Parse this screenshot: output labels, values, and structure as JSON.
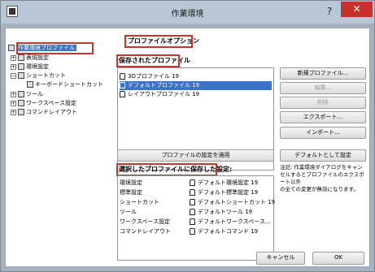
{
  "window": {
    "title": "作業環境",
    "help_glyph": "?",
    "close_glyph": "✕"
  },
  "tree": {
    "items": [
      {
        "label": "作業環境プロファイル",
        "expander": "",
        "selected": true
      },
      {
        "label": "表現設定",
        "expander": "+"
      },
      {
        "label": "環境設定",
        "expander": "+"
      },
      {
        "label": "ショートカット",
        "expander": "−"
      },
      {
        "label": "キーボードショートカット",
        "expander": ""
      },
      {
        "label": "ツール",
        "expander": "+"
      },
      {
        "label": "ワークスペース設定",
        "expander": "+"
      },
      {
        "label": "コマンドレイアウト",
        "expander": "+"
      }
    ]
  },
  "main": {
    "section_title": "プロファイルオプション",
    "saved_profiles_label": "保存されたプロファイル",
    "saved_profiles": [
      {
        "label": "3Dプロファイル 19",
        "selected": false
      },
      {
        "label": "デフォルトプロファイル 19",
        "selected": true
      },
      {
        "label": "レイアウトプロファイル 19",
        "selected": false
      }
    ],
    "buttons": {
      "new_profile": "新規プロファイル...",
      "edit": "編集...",
      "delete": "削除",
      "export": "エクスポート...",
      "import": "インポート...",
      "apply_profile": "プロファイルの設定を適用",
      "set_default": "デフォルトとして設定"
    },
    "stored_settings_label": "選択したプロファイルに保存した設定:",
    "stored_settings": [
      {
        "name": "環境設定",
        "value": "デフォルト環境設定 19"
      },
      {
        "name": "標準設定",
        "value": "デフォルト標準設定 19"
      },
      {
        "name": "ショートカット",
        "value": "デフォルトショートカット 19"
      },
      {
        "name": "ツール",
        "value": "デフォルトツール 19"
      },
      {
        "name": "ワークスペース設定",
        "value": "デフォルトワークスペース..."
      },
      {
        "name": "コマンドレイアウト",
        "value": "デフォルトコマンド 19"
      }
    ],
    "note_line1": "注記: 作業環境ダイアログをキャン",
    "note_line2": "セルするとプロファイルのエクスポート以外",
    "note_line3": "の全ての変更が無効になります。"
  },
  "footer": {
    "cancel": "キャンセル",
    "ok": "OK"
  }
}
